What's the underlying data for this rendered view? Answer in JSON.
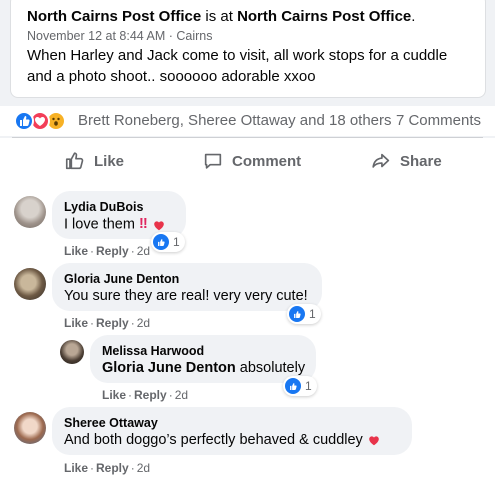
{
  "post": {
    "author": "North Cairns Post Office",
    "connector": " is at ",
    "location": "North Cairns Post Office",
    "period": ".",
    "date": "November 12 at 8:44 AM",
    "dot": " · ",
    "place": "Cairns",
    "body_line1": "When Harley and Jack come to visit,  all work stops for a cuddle",
    "body_line2": "and a photo shoot.. soooooo adorable  xxoo"
  },
  "reactions": {
    "icons": [
      "like-icon",
      "love-icon",
      "wow-icon"
    ],
    "names": "Brett Roneberg, Sheree Ottaway and 18 others",
    "comments": "7 Comments"
  },
  "actions": {
    "like": "Like",
    "comment": "Comment",
    "share": "Share"
  },
  "comments": [
    {
      "name": "Lydia DuBois",
      "text": "I love them",
      "like": "Like",
      "reply": "Reply",
      "time": "2d",
      "reaction_count": "1"
    },
    {
      "name": "Gloria June Denton",
      "text": "You sure they are real! very very cute!",
      "like": "Like",
      "reply": "Reply",
      "time": "2d",
      "reaction_count": "1"
    },
    {
      "name": "Melissa Harwood",
      "mention": "Gloria June Denton",
      "text": " absolutely",
      "like": "Like",
      "reply": "Reply",
      "time": "2d",
      "reaction_count": "1"
    },
    {
      "name": "Sheree Ottaway",
      "text": "And both doggo’s perfectly behaved & cuddley",
      "like": "Like",
      "reply": "Reply",
      "time": "2d"
    }
  ],
  "colors": {
    "accent": "#1877f2",
    "love": "#f33e58",
    "wow": "#f7b125",
    "muted": "#65676b"
  }
}
